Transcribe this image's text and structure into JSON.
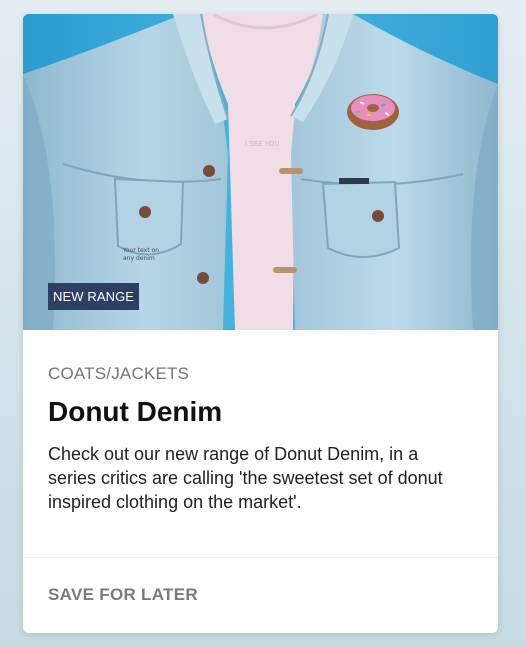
{
  "card": {
    "badge": "NEW RANGE",
    "category": "COATS/JACKETS",
    "title": "Donut Denim",
    "description": "Check out our new range of Donut Denim, in a series critics are calling 'the sweetest set of donut inspired clothing on the market'.",
    "action_label": "SAVE FOR LATER",
    "image_icon": "denim-jacket-photo"
  },
  "colors": {
    "badge_bg": "#2d3f63",
    "photo_bg": "#3fb1de",
    "denim": "#a9cde0",
    "tshirt": "#f0dbe4",
    "donut_icing": "#e98fbf"
  }
}
